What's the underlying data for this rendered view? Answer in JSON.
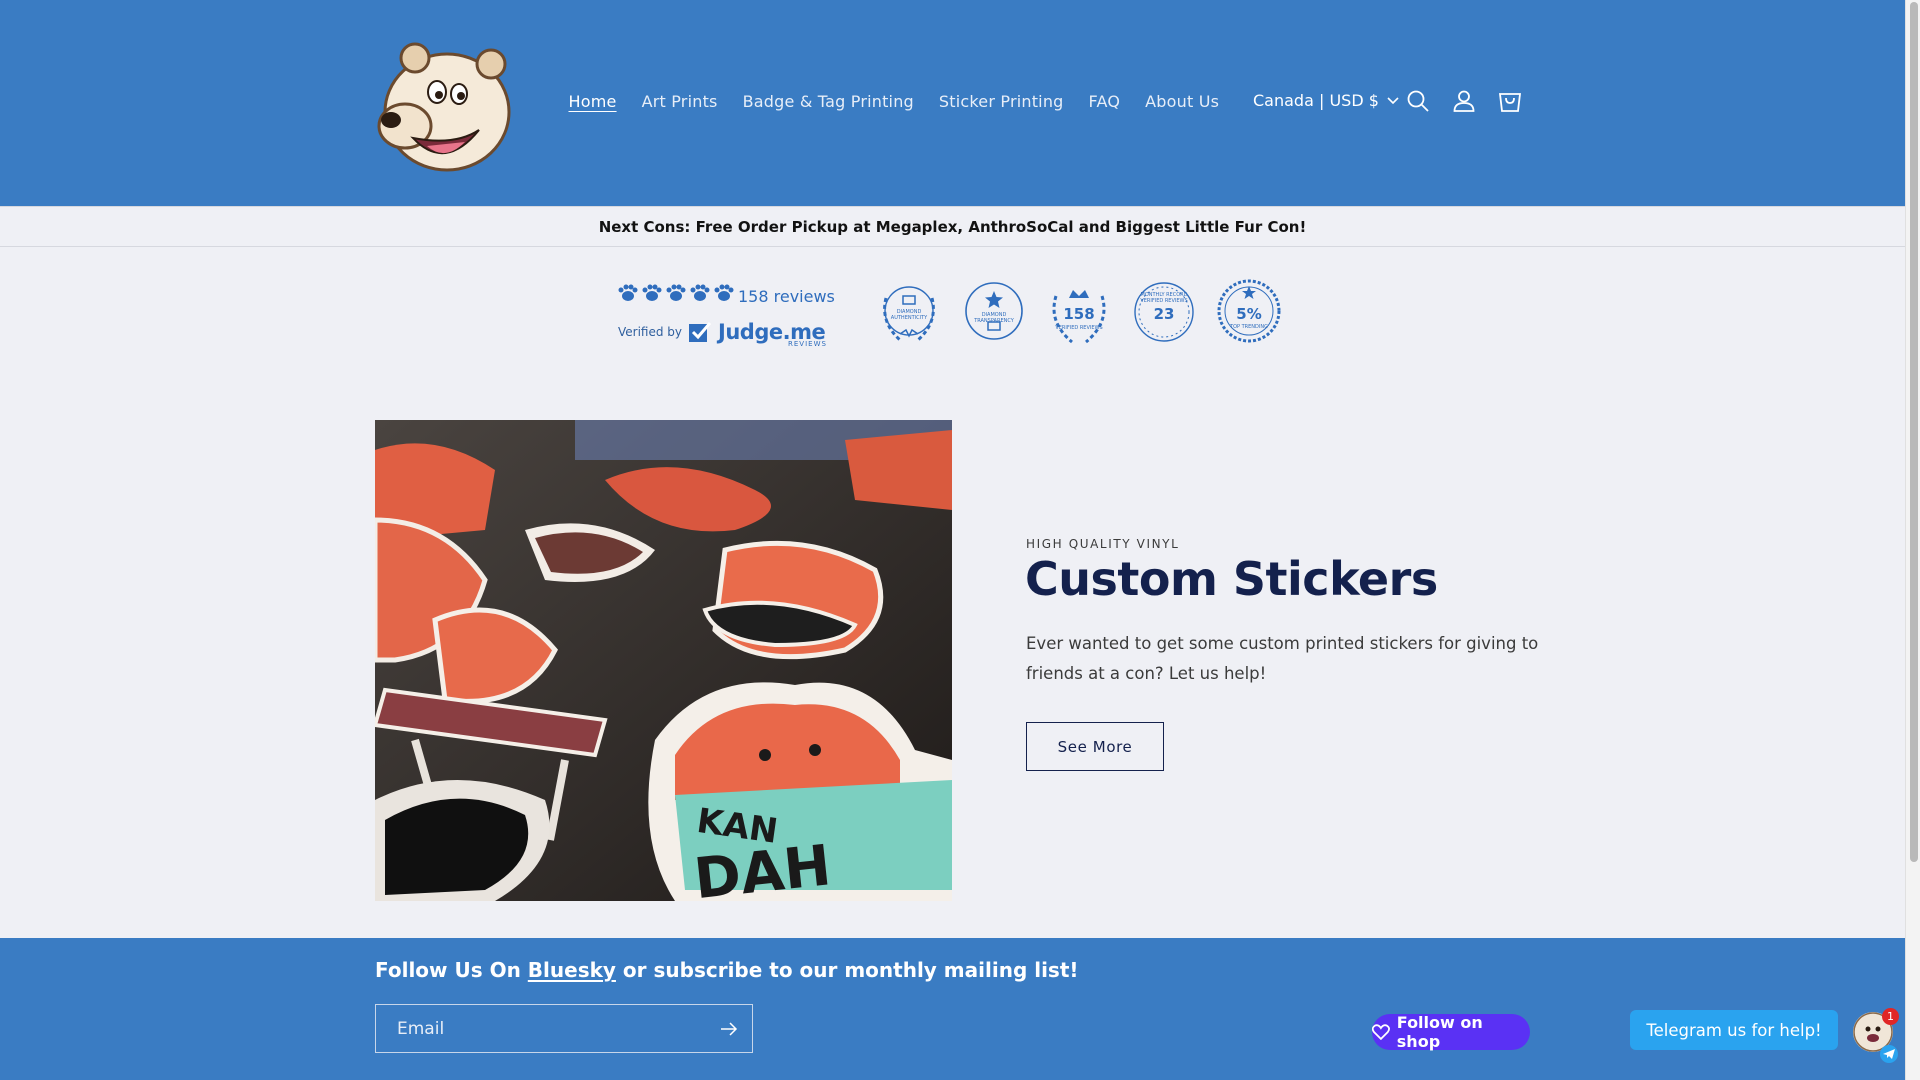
{
  "header": {
    "logo_alt": "bear mascot logo",
    "nav": [
      {
        "label": "Home",
        "active": true
      },
      {
        "label": "Art Prints",
        "active": false
      },
      {
        "label": "Badge & Tag Printing",
        "active": false
      },
      {
        "label": "Sticker Printing",
        "active": false
      },
      {
        "label": "FAQ",
        "active": false
      },
      {
        "label": "About Us",
        "active": false
      }
    ],
    "locale": "Canada | USD $",
    "icons": [
      "search-icon",
      "account-icon",
      "cart-icon"
    ]
  },
  "announcement": "Next Cons: Free Order Pickup at Megaplex, AnthroSoCal and Biggest Little Fur Con!",
  "reviews": {
    "count_label": "158 reviews",
    "verified_by": "Verified by",
    "brand": "Judge.me",
    "brand_sub": "REVIEWS",
    "badges": [
      {
        "big": "",
        "small": "DIAMOND AUTHENTICITY"
      },
      {
        "big": "",
        "small": "DIAMOND TRANSPARENCY"
      },
      {
        "big": "158",
        "small": "VERIFIED REVIEWS"
      },
      {
        "big": "23",
        "small": "MONTHLY RECORD VERIFIED REVIEWS"
      },
      {
        "big": "5%",
        "small": "TOP TRENDING"
      }
    ]
  },
  "hero": {
    "eyebrow": "HIGH QUALITY VINYL",
    "title": "Custom Stickers",
    "text": "Ever wanted to get some custom printed stickers for giving to friends at a con? Let us help!",
    "button": "See More",
    "image_text_1": "KAN",
    "image_text_2": "DAH"
  },
  "footer": {
    "follow_prefix": "Follow Us On ",
    "follow_link": "Bluesky",
    "follow_suffix": " or subscribe to our monthly mailing list!",
    "email_placeholder": "Email",
    "shop_button": "Follow on shop",
    "telegram_button": "Telegram us for help!",
    "notification_count": "1"
  },
  "colors": {
    "header_bg": "#3a7cc3",
    "page_bg": "#eff0f5",
    "title": "#14214d",
    "shop": "#5a31f4",
    "telegram": "#2aa3ef"
  }
}
